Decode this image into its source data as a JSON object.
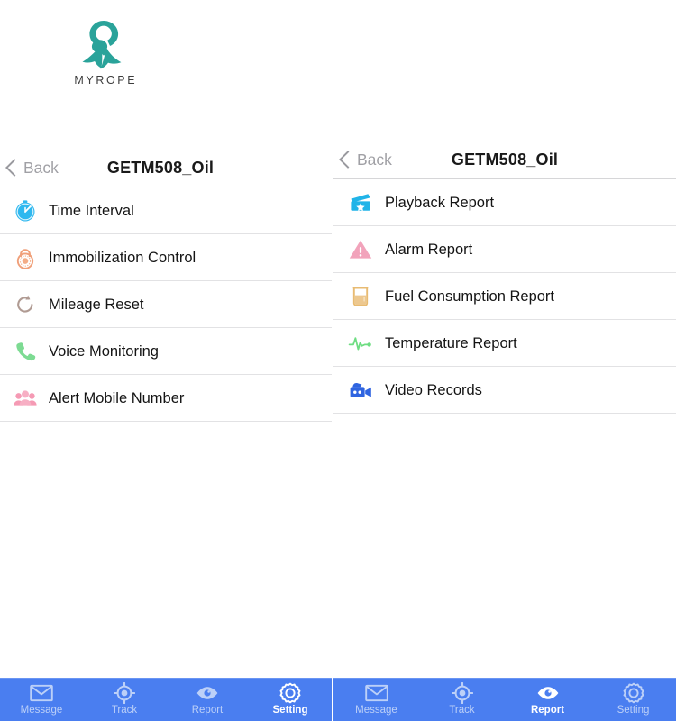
{
  "brand": {
    "logo_icon": "myrope-ribbon-logo",
    "wordmark": "MYROPE",
    "color": "#2aa39a"
  },
  "left_screen": {
    "navbar": {
      "back_label": "Back",
      "back_icon": "chevron-left-icon",
      "title": "GETM508_Oil"
    },
    "items": [
      {
        "label": "Time Interval",
        "icon": "stopwatch-icon",
        "color": "#2fb8ef"
      },
      {
        "label": "Immobilization Control",
        "icon": "padlock-icon",
        "color": "#f0a07a"
      },
      {
        "label": "Mileage Reset",
        "icon": "refresh-icon",
        "color": "#b09b93"
      },
      {
        "label": "Voice Monitoring",
        "icon": "phone-icon",
        "color": "#7ddb93"
      },
      {
        "label": "Alert Mobile Number",
        "icon": "group-users-icon",
        "color": "#f59ab4"
      }
    ],
    "tabs": [
      {
        "label": "Message",
        "icon": "envelope-icon",
        "active": false
      },
      {
        "label": "Track",
        "icon": "crosshair-icon",
        "active": false
      },
      {
        "label": "Report",
        "icon": "eye-icon",
        "active": false
      },
      {
        "label": "Setting",
        "icon": "gear-icon",
        "active": true
      }
    ]
  },
  "right_screen": {
    "navbar": {
      "back_label": "Back",
      "back_icon": "chevron-left-icon",
      "title": "GETM508_Oil"
    },
    "items": [
      {
        "label": "Playback Report",
        "icon": "ticket-star-icon",
        "color": "#21b4e8"
      },
      {
        "label": "Alarm Report",
        "icon": "warning-triangle-icon",
        "color": "#f2a3bb"
      },
      {
        "label": "Fuel Consumption Report",
        "icon": "fuel-beaker-icon",
        "color": "#e8bb72"
      },
      {
        "label": "Temperature Report",
        "icon": "pulse-line-icon",
        "color": "#6edd82"
      },
      {
        "label": "Video Records",
        "icon": "video-camera-icon",
        "color": "#2f64e0"
      }
    ],
    "tabs": [
      {
        "label": "Message",
        "icon": "envelope-icon",
        "active": false
      },
      {
        "label": "Track",
        "icon": "crosshair-icon",
        "active": false
      },
      {
        "label": "Report",
        "icon": "eye-icon",
        "active": true
      },
      {
        "label": "Setting",
        "icon": "gear-icon",
        "active": false
      }
    ]
  },
  "theme": {
    "tabbar_bg": "#4a7ef0",
    "tabbar_inactive": "#bcd0f8",
    "tabbar_active": "#ffffff",
    "separator": "#e2e2e4",
    "text": "#141414"
  }
}
